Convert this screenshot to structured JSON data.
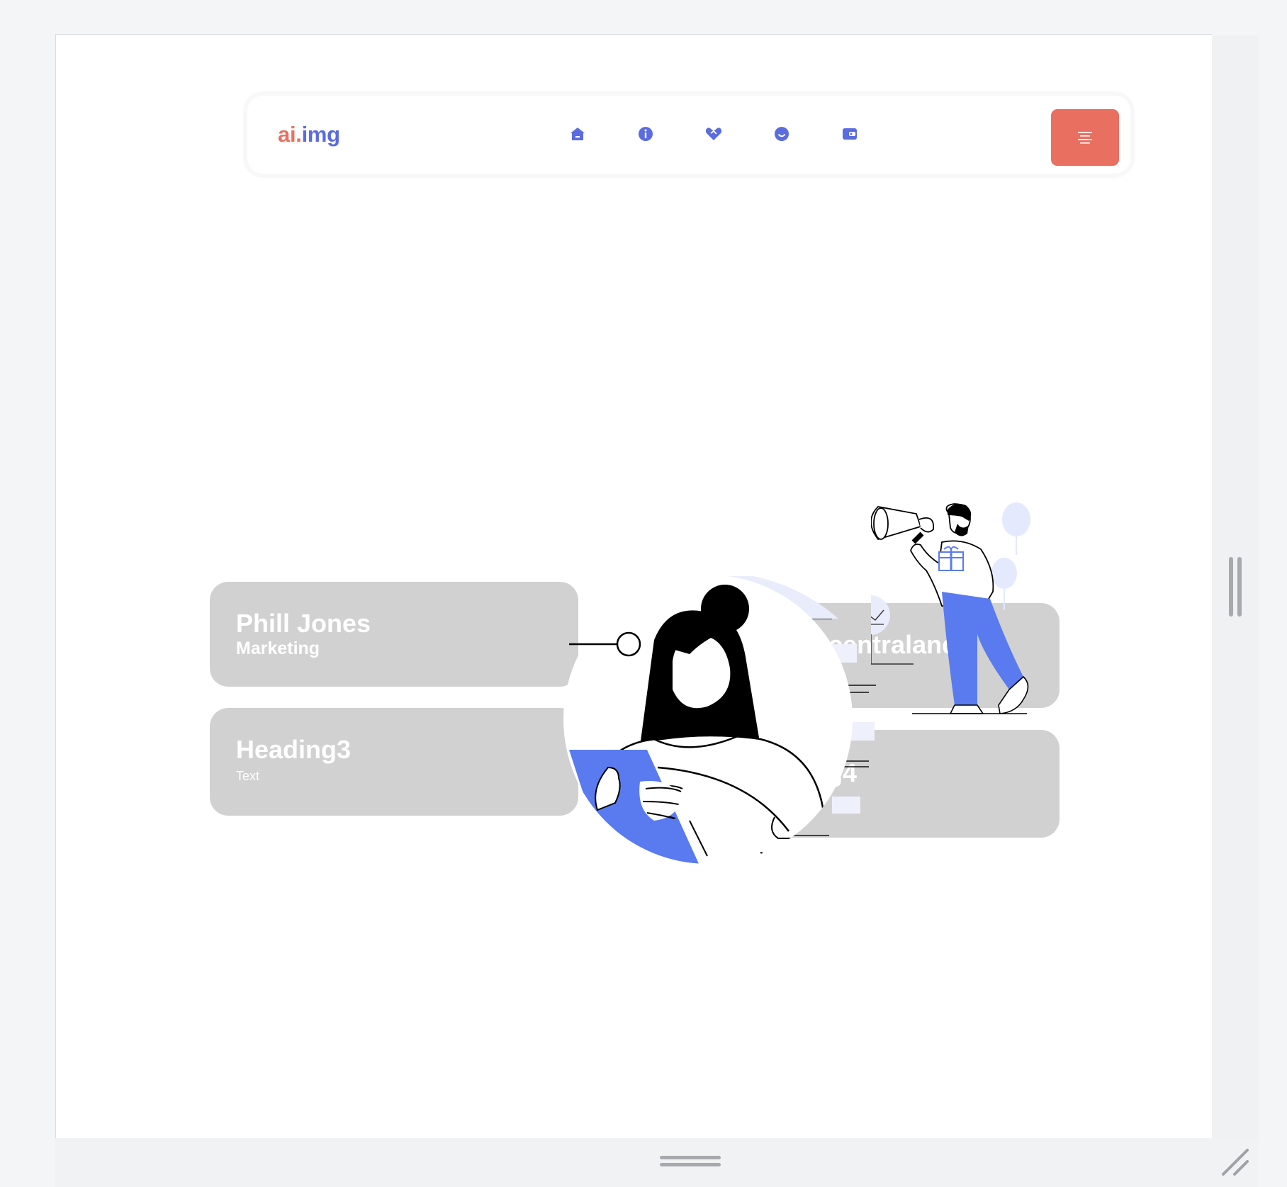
{
  "app": {
    "logo_part1": "ai.",
    "logo_part2": "img"
  },
  "nav": {
    "icons": [
      "home-icon",
      "info-icon",
      "handshake-icon",
      "smile-icon",
      "wallet-icon"
    ],
    "menu_icon": "menu-icon"
  },
  "cards": [
    {
      "title": "Phill Jones",
      "subtitle": "Marketing"
    },
    {
      "title": "Heading3",
      "subtitle": "Text"
    },
    {
      "title": "Decentraland",
      "title_visible": "ecentraland",
      "subtitle": ""
    },
    {
      "title": "Heading4",
      "title_visible": "ng4",
      "subtitle": ""
    }
  ],
  "colors": {
    "accent_red": "#e97061",
    "accent_blue": "#5b6be0",
    "illustration_blue": "#5a7bef",
    "card_gray": "#d1d1d1",
    "page_bg": "#ffffff"
  }
}
